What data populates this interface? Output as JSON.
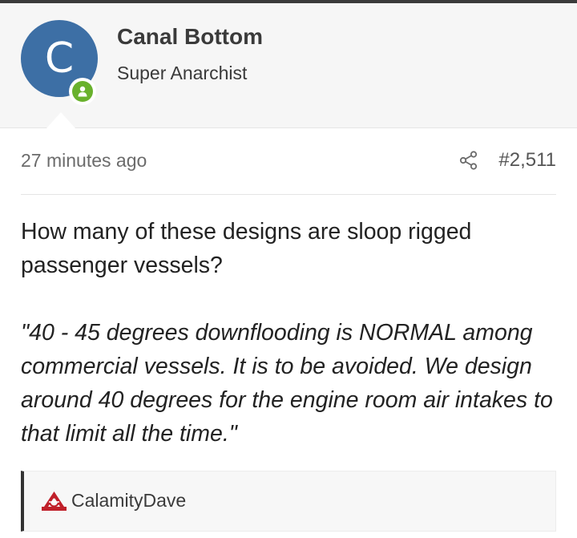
{
  "author": {
    "avatar_letter": "C",
    "avatar_color": "#3d6fa5",
    "online_status_color": "#69b12d",
    "name": "Canal Bottom",
    "rank": "Super Anarchist"
  },
  "post_meta": {
    "timestamp": "27 minutes ago",
    "share_icon": "share-icon",
    "post_number": "#2,511"
  },
  "post": {
    "body": "How many of these designs are sloop rigged passenger vessels?",
    "quote": "\"40 - 45 degrees downflooding is NORMAL among commercial vessels. It is to be avoided. We design around 40 degrees for the engine room air intakes to that limit all the time.\""
  },
  "signature": {
    "logo_icon": "anarchy-logo-icon",
    "logo_color": "#c0202a",
    "name": "CalamityDave"
  }
}
